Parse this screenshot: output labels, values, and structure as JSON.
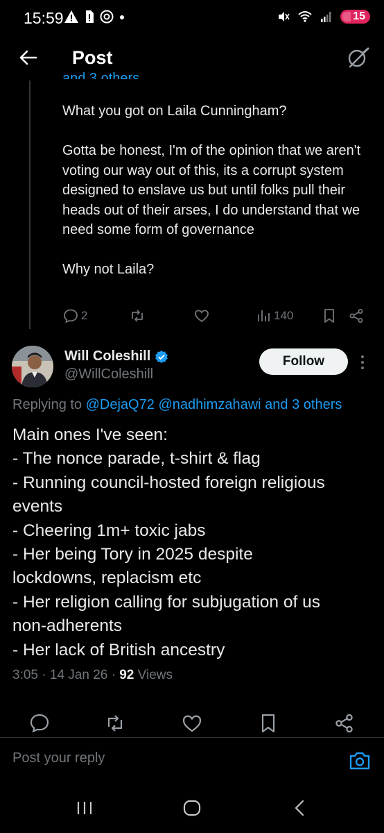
{
  "status_bar": {
    "time": "15:59",
    "battery": "15",
    "left_icons": [
      "warning-icon",
      "sim-icon",
      "threads-icon",
      "dot-icon"
    ],
    "right_icons": [
      "mute-icon",
      "wifi-icon",
      "signal-icon",
      "battery-icon"
    ]
  },
  "header": {
    "title": "Post",
    "back_icon": "arrow-left-icon",
    "grok_icon": "grok-icon"
  },
  "previous_post": {
    "replying_fragment": "and 3 others",
    "text": "What you got on Laila Cunningham?\n\nGotta be honest, I'm of the opinion that we aren't voting our way out of this, its a corrupt system designed to enslave us but until folks pull their heads out of their arses, I do understand that we need some form of governance\n\nWhy not Laila?",
    "replies": "2",
    "views": "140"
  },
  "main_post": {
    "name": "Will Coleshill",
    "handle": "@WillColeshill",
    "follow_label": "Follow",
    "replying_prefix": "Replying to",
    "mentions": [
      "@DejaQ72",
      "@nadhimzahawi",
      "and 3 others"
    ],
    "lines": [
      "Main ones I've seen:",
      "- The nonce parade, t-shirt & flag",
      "- Running council-hosted foreign religious",
      "events",
      "- Cheering 1m+ toxic jabs",
      "- Her being Tory in 2025 despite",
      "lockdowns, replacism etc",
      "- Her religion calling for subjugation of us",
      "non-adherents",
      "- Her lack of British ancestry"
    ],
    "time": "3:05",
    "date": "14 Jan 26",
    "views_count": "92",
    "views_label": "Views"
  },
  "reply_bar": {
    "placeholder": "Post your reply"
  },
  "colors": {
    "background": "#000000",
    "text": "#e7e9ea",
    "muted": "#71767b",
    "accent": "#1d9bf0",
    "verified": "#1d9bf0"
  }
}
